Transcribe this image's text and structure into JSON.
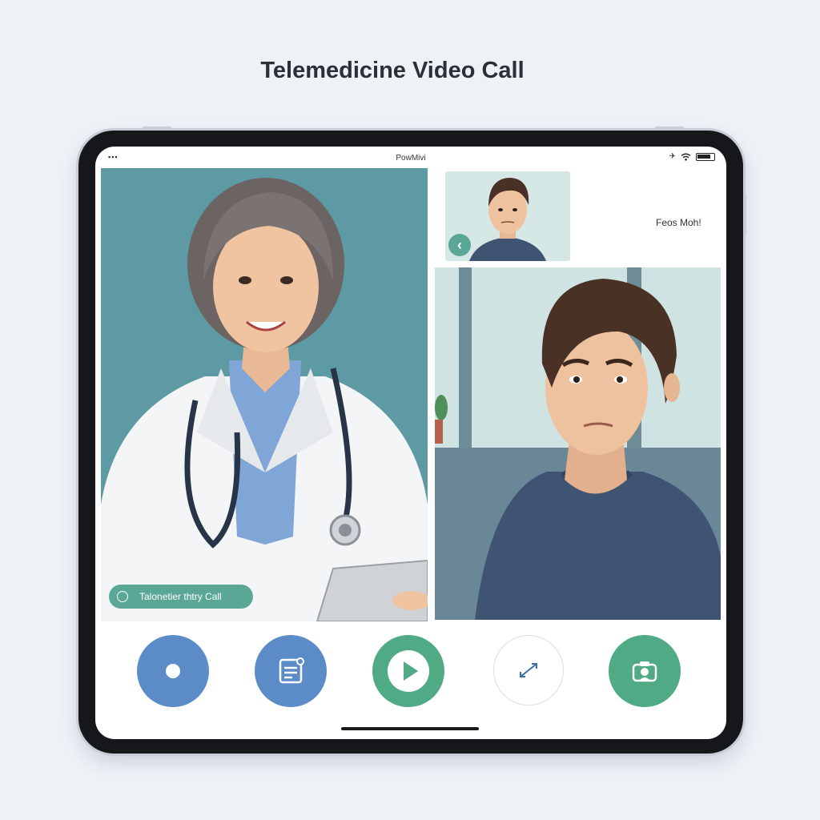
{
  "page": {
    "title": "Telemedicine Video Call"
  },
  "status_bar": {
    "left": "▪▪▪",
    "center": "PowMivi",
    "right_icons": [
      "airplane-icon",
      "wifi-icon",
      "battery-icon"
    ]
  },
  "doctor_view": {
    "caption": "Talonetier thtry Call"
  },
  "self_view": {
    "side_label": "Feos Moh!"
  },
  "controls": [
    {
      "name": "record-button",
      "icon": "record-icon",
      "color": "#5b8cc8"
    },
    {
      "name": "notes-button",
      "icon": "notes-icon",
      "color": "#5b8cc8"
    },
    {
      "name": "play-button",
      "icon": "play-icon",
      "color": "#4faa85"
    },
    {
      "name": "expand-button",
      "icon": "expand-arrows-icon",
      "color": "#ffffff"
    },
    {
      "name": "camera-button",
      "icon": "camera-icon",
      "color": "#4faa85"
    }
  ],
  "colors": {
    "accent_green": "#5ba795",
    "accent_blue": "#5b8cc8",
    "doctor_background": "#5e9aa3",
    "patient_shirt": "#3f5373"
  }
}
